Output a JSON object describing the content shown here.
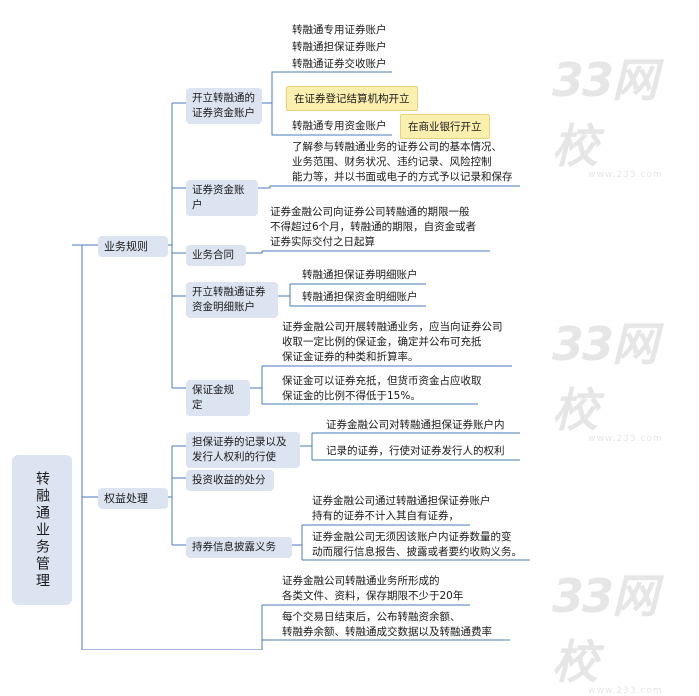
{
  "root": "转融通业务管理",
  "watermark": {
    "text": "33网校",
    "sub": "www.233.com"
  },
  "branches": {
    "business_rules": {
      "label": "业务规则",
      "open_account": {
        "label": "开立转融通的\n证券资金账户",
        "accounts": [
          "转融通专用证券账户",
          "转融通担保证券账户",
          "转融通证券交收账户"
        ],
        "callout_1": "在证券登记结算机构开立",
        "fund_account": "转融通专用资金账户",
        "callout_2": "在商业银行开立"
      },
      "securities_fund_account": {
        "label": "证券资金账户",
        "text": "了解参与转融通业务的证券公司的基本情况、\n业务范围、财务状况、违约记录、风险控制\n能力等，并以书面或电子的方式予以记录和保存"
      },
      "contract": {
        "label": "业务合同",
        "text": "证券金融公司向证券公司转融通的期限一般\n不得超过6个月，转融通的期限，自资金或者\n证券实际交付之日起算"
      },
      "detail_account": {
        "label": "开立转融通证券\n资金明细账户",
        "items": [
          "转融通担保证券明细账户",
          "转融通担保资金明细账户"
        ]
      },
      "margin": {
        "label": "保证金规定",
        "items": [
          "证券金融公司开展转融通业务，应当向证券公司\n收取一定比例的保证金，确定并公布可充抵\n保证金证券的种类和折算率。",
          "保证金可以证券充抵，但货币资金占应收取\n保证金的比例不得低于15%。"
        ]
      }
    },
    "rights": {
      "label": "权益处理",
      "collateral_record": {
        "label": "担保证券的记录以及\n发行人权利的行使",
        "items": [
          "证券金融公司对转融通担保证券账户内",
          "记录的证券，行使对证券发行人的权利"
        ]
      },
      "investment_income": {
        "label": "投资收益的处分"
      },
      "disclosure": {
        "label": "持券信息披露义务",
        "items": [
          "证券金融公司通过转融通担保证券账户\n持有的证券不计入其自有证券，",
          "证券金融公司无须因该账户内证券数量的变\n动而履行信息报告、披露或者要约收购义务。"
        ]
      }
    },
    "bottom_texts": [
      "证券金融公司转融通业务所形成的\n各类文件、资料，保存期限不少于20年",
      "每个交易日结束后，公布转融资余额、\n转融券余额、转融通成交数据以及转融通费率"
    ]
  }
}
